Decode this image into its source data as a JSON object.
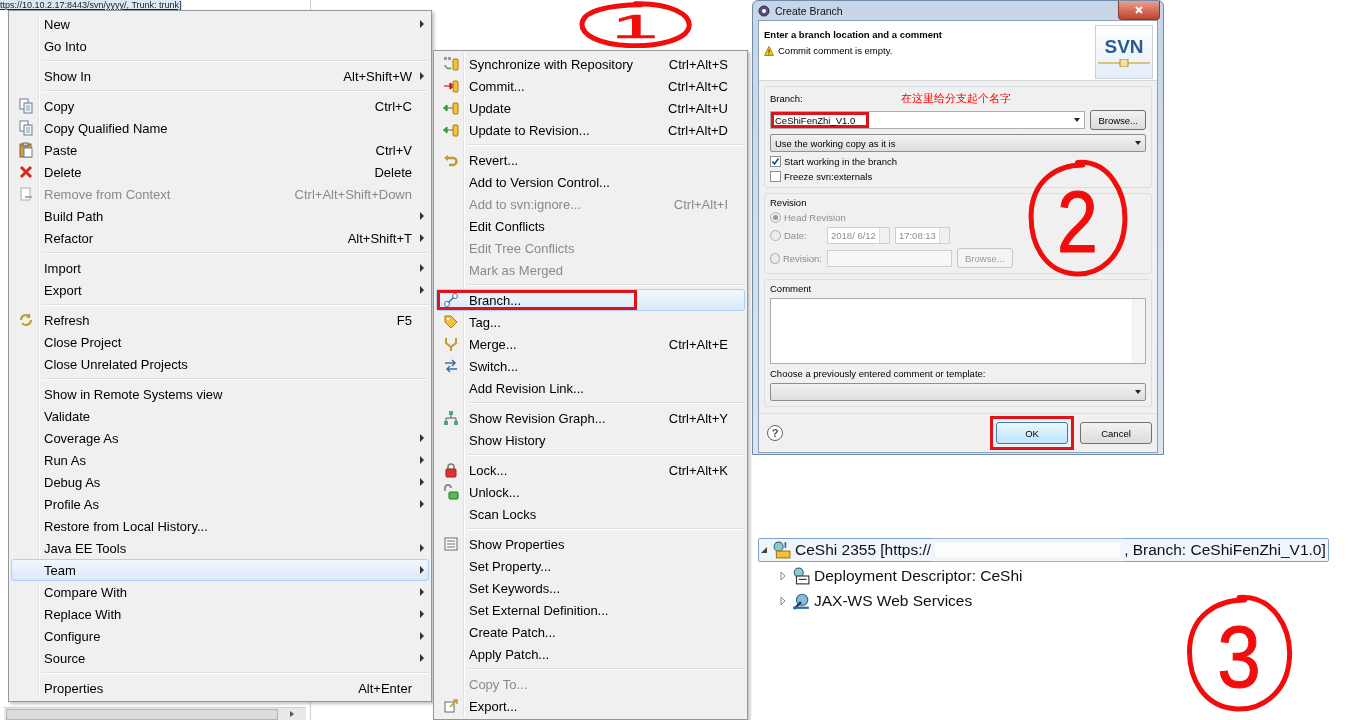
{
  "background": {
    "path_text": "ttps://10.10.2.17:8443/svn/yyyy/, Trunk: trunk]"
  },
  "context_menu": {
    "groups": [
      {
        "items": [
          {
            "label": "New",
            "has_submenu": true,
            "disabled": false,
            "selected": false
          },
          {
            "label": "Go Into",
            "has_submenu": false,
            "disabled": false,
            "selected": false
          }
        ]
      },
      {
        "items": [
          {
            "label": "Show In",
            "shortcut": "Alt+Shift+W",
            "has_submenu": true,
            "disabled": false,
            "selected": false
          }
        ]
      },
      {
        "items": [
          {
            "label": "Copy",
            "shortcut": "Ctrl+C",
            "has_submenu": false,
            "disabled": false,
            "selected": false
          },
          {
            "label": "Copy Qualified Name",
            "has_submenu": false,
            "disabled": false,
            "selected": false
          },
          {
            "label": "Paste",
            "shortcut": "Ctrl+V",
            "has_submenu": false,
            "disabled": false,
            "selected": false
          },
          {
            "label": "Delete",
            "shortcut": "Delete",
            "has_submenu": false,
            "disabled": false,
            "selected": false
          },
          {
            "label": "Remove from Context",
            "shortcut": "Ctrl+Alt+Shift+Down",
            "has_submenu": false,
            "disabled": true,
            "selected": false
          },
          {
            "label": "Build Path",
            "has_submenu": true,
            "disabled": false,
            "selected": false
          },
          {
            "label": "Refactor",
            "shortcut": "Alt+Shift+T",
            "has_submenu": true,
            "disabled": false,
            "selected": false
          }
        ]
      },
      {
        "items": [
          {
            "label": "Import",
            "has_submenu": true,
            "disabled": false,
            "selected": false
          },
          {
            "label": "Export",
            "has_submenu": true,
            "disabled": false,
            "selected": false
          }
        ]
      },
      {
        "items": [
          {
            "label": "Refresh",
            "shortcut": "F5",
            "has_submenu": false,
            "disabled": false,
            "selected": false
          },
          {
            "label": "Close Project",
            "has_submenu": false,
            "disabled": false,
            "selected": false
          },
          {
            "label": "Close Unrelated Projects",
            "has_submenu": false,
            "disabled": false,
            "selected": false
          }
        ]
      },
      {
        "items": [
          {
            "label": "Show in Remote Systems view",
            "has_submenu": false,
            "disabled": false,
            "selected": false
          },
          {
            "label": "Validate",
            "has_submenu": false,
            "disabled": false,
            "selected": false
          },
          {
            "label": "Coverage As",
            "has_submenu": true,
            "disabled": false,
            "selected": false
          },
          {
            "label": "Run As",
            "has_submenu": true,
            "disabled": false,
            "selected": false
          },
          {
            "label": "Debug As",
            "has_submenu": true,
            "disabled": false,
            "selected": false
          },
          {
            "label": "Profile As",
            "has_submenu": true,
            "disabled": false,
            "selected": false
          },
          {
            "label": "Restore from Local History...",
            "has_submenu": false,
            "disabled": false,
            "selected": false
          },
          {
            "label": "Java EE Tools",
            "has_submenu": true,
            "disabled": false,
            "selected": false
          },
          {
            "label": "Team",
            "has_submenu": true,
            "disabled": false,
            "selected": true
          },
          {
            "label": "Compare With",
            "has_submenu": true,
            "disabled": false,
            "selected": false
          },
          {
            "label": "Replace With",
            "has_submenu": true,
            "disabled": false,
            "selected": false
          },
          {
            "label": "Configure",
            "has_submenu": true,
            "disabled": false,
            "selected": false
          },
          {
            "label": "Source",
            "has_submenu": true,
            "disabled": false,
            "selected": false
          }
        ]
      },
      {
        "items": [
          {
            "label": "Properties",
            "shortcut": "Alt+Enter",
            "has_submenu": false,
            "disabled": false,
            "selected": false
          }
        ]
      }
    ]
  },
  "team_menu": {
    "groups": [
      {
        "items": [
          {
            "label": "Synchronize with Repository",
            "shortcut": "Ctrl+Alt+S",
            "disabled": false,
            "selected": false,
            "highlighted": false
          },
          {
            "label": "Commit...",
            "shortcut": "Ctrl+Alt+C",
            "disabled": false,
            "selected": false,
            "highlighted": false
          },
          {
            "label": "Update",
            "shortcut": "Ctrl+Alt+U",
            "disabled": false,
            "selected": false,
            "highlighted": false
          },
          {
            "label": "Update to Revision...",
            "shortcut": "Ctrl+Alt+D",
            "disabled": false,
            "selected": false,
            "highlighted": false
          }
        ]
      },
      {
        "items": [
          {
            "label": "Revert...",
            "disabled": false,
            "selected": false,
            "highlighted": false
          },
          {
            "label": "Add to Version Control...",
            "disabled": false,
            "selected": false,
            "highlighted": false
          },
          {
            "label": "Add to svn:ignore...",
            "shortcut": "Ctrl+Alt+I",
            "disabled": true,
            "selected": false,
            "highlighted": false
          },
          {
            "label": "Edit Conflicts",
            "disabled": false,
            "selected": false,
            "highlighted": false
          },
          {
            "label": "Edit Tree Conflicts",
            "disabled": true,
            "selected": false,
            "highlighted": false
          },
          {
            "label": "Mark as Merged",
            "disabled": true,
            "selected": false,
            "highlighted": false
          }
        ]
      },
      {
        "items": [
          {
            "label": "Branch...",
            "disabled": false,
            "selected": true,
            "highlighted": true
          },
          {
            "label": "Tag...",
            "disabled": false,
            "selected": false,
            "highlighted": false
          },
          {
            "label": "Merge...",
            "shortcut": "Ctrl+Alt+E",
            "disabled": false,
            "selected": false,
            "highlighted": false
          },
          {
            "label": "Switch...",
            "disabled": false,
            "selected": false,
            "highlighted": false
          },
          {
            "label": "Add Revision Link...",
            "disabled": false,
            "selected": false,
            "highlighted": false
          }
        ]
      },
      {
        "items": [
          {
            "label": "Show Revision Graph...",
            "shortcut": "Ctrl+Alt+Y",
            "disabled": false,
            "selected": false,
            "highlighted": false
          },
          {
            "label": "Show History",
            "disabled": false,
            "selected": false,
            "highlighted": false
          }
        ]
      },
      {
        "items": [
          {
            "label": "Lock...",
            "shortcut": "Ctrl+Alt+K",
            "disabled": false,
            "selected": false,
            "highlighted": false
          },
          {
            "label": "Unlock...",
            "disabled": false,
            "selected": false,
            "highlighted": false
          },
          {
            "label": "Scan Locks",
            "disabled": false,
            "selected": false,
            "highlighted": false
          }
        ]
      },
      {
        "items": [
          {
            "label": "Show Properties",
            "disabled": false,
            "selected": false,
            "highlighted": false
          },
          {
            "label": "Set Property...",
            "disabled": false,
            "selected": false,
            "highlighted": false
          },
          {
            "label": "Set Keywords...",
            "disabled": false,
            "selected": false,
            "highlighted": false
          },
          {
            "label": "Set External Definition...",
            "disabled": false,
            "selected": false,
            "highlighted": false
          },
          {
            "label": "Create Patch...",
            "disabled": false,
            "selected": false,
            "highlighted": false
          },
          {
            "label": "Apply Patch...",
            "disabled": false,
            "selected": false,
            "highlighted": false
          }
        ]
      },
      {
        "items": [
          {
            "label": "Copy To...",
            "disabled": true,
            "selected": false,
            "highlighted": false
          },
          {
            "label": "Export...",
            "disabled": false,
            "selected": false,
            "highlighted": false
          }
        ]
      }
    ]
  },
  "dialog": {
    "title": "Create Branch",
    "header": {
      "title": "Enter a branch location and a comment",
      "message": "Commit comment is empty.",
      "logo_text": "SVN"
    },
    "branch": {
      "group_label": "Branch:",
      "note": "在这里给分支起个名字",
      "value": "CeShiFenZhi_V1.0",
      "highlighted": true,
      "browse_button": "Browse...",
      "source_option": "Use the working copy as it is",
      "checkboxes": [
        {
          "label": "Start working in the branch",
          "checked": true
        },
        {
          "label": "Freeze svn:externals",
          "checked": false
        }
      ]
    },
    "revision": {
      "group_label": "Revision",
      "disabled": true,
      "options": [
        {
          "kind": "plain",
          "label": "Head Revision",
          "selected": true
        },
        {
          "kind": "date",
          "label": "Date:",
          "date": "2018/  6/12",
          "time": "17:08:13",
          "selected": false
        },
        {
          "kind": "number",
          "label": "Revision:",
          "button": "Browse...",
          "selected": false
        }
      ]
    },
    "comment": {
      "group_label": "Comment",
      "template_label": "Choose a previously entered comment or template:"
    },
    "help_symbol": "?",
    "buttons": [
      {
        "label": "OK",
        "default": true,
        "highlighted": true
      },
      {
        "label": "Cancel",
        "default": false,
        "highlighted": false
      }
    ]
  },
  "tree": {
    "items": [
      {
        "label_parts": [
          "CeShi 2355 [https://",
          ", Branch: CeShiFenZhi_V1.0]"
        ],
        "redacted": true,
        "expanded": true,
        "selected": true,
        "children": [
          {
            "label": "Deployment Descriptor: CeShi",
            "expanded": false
          },
          {
            "label": "JAX-WS Web Services",
            "expanded": false
          }
        ]
      }
    ]
  },
  "annotations": [
    {
      "label": "1"
    },
    {
      "label": "2"
    },
    {
      "label": "3"
    }
  ]
}
